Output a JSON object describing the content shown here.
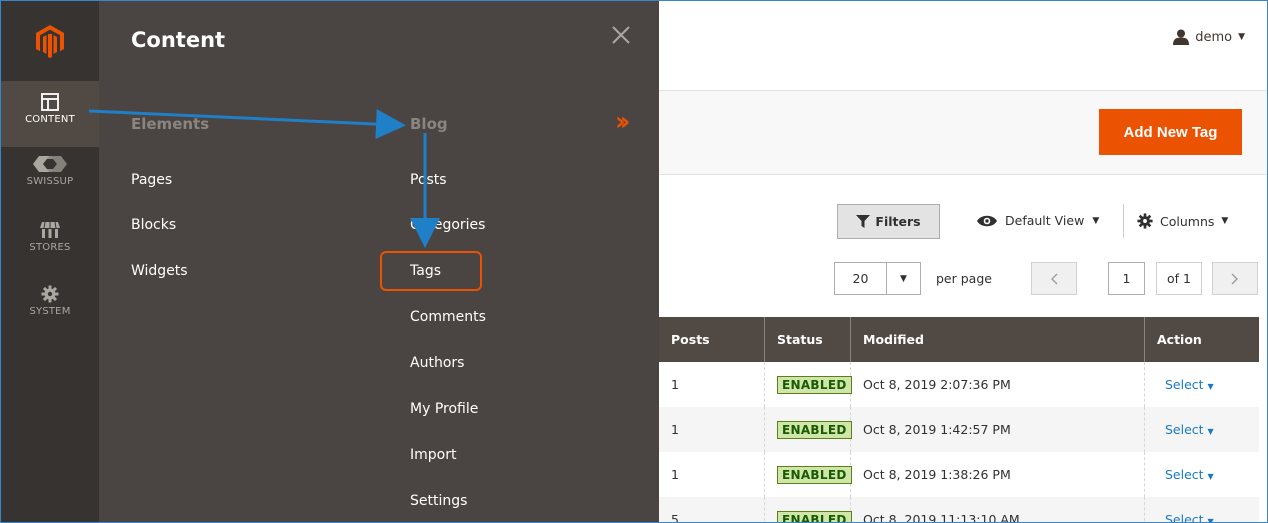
{
  "sidebar": {
    "logo": "magento-logo",
    "items": [
      {
        "label": "CONTENT",
        "icon": "layout-icon",
        "active": true
      },
      {
        "label": "SWISSUP",
        "icon": "swissup-icon",
        "active": false
      },
      {
        "label": "STORES",
        "icon": "store-icon",
        "active": false
      },
      {
        "label": "SYSTEM",
        "icon": "gear-icon",
        "active": false
      }
    ]
  },
  "menu": {
    "title": "Content",
    "elements": {
      "heading": "Elements",
      "links": [
        "Pages",
        "Blocks",
        "Widgets"
      ]
    },
    "blog": {
      "heading": "Blog",
      "links": [
        "Posts",
        "Categories",
        "Tags",
        "Comments",
        "Authors",
        "My Profile",
        "Import",
        "Settings"
      ]
    }
  },
  "header": {
    "user": "demo"
  },
  "page": {
    "add_button": "Add New Tag"
  },
  "toolbar": {
    "filters": "Filters",
    "view": "Default View",
    "columns": "Columns",
    "per_page_value": "20",
    "per_page_label": "per page",
    "page_number": "1",
    "page_of": "of 1"
  },
  "table": {
    "columns": [
      "Posts",
      "Status",
      "Modified",
      "Action"
    ],
    "rows": [
      {
        "posts": "1",
        "status": "ENABLED",
        "modified": "Oct 8, 2019 2:07:36 PM",
        "action": "Select"
      },
      {
        "posts": "1",
        "status": "ENABLED",
        "modified": "Oct 8, 2019 1:42:57 PM",
        "action": "Select"
      },
      {
        "posts": "1",
        "status": "ENABLED",
        "modified": "Oct 8, 2019 1:38:26 PM",
        "action": "Select"
      },
      {
        "posts": "5",
        "status": "ENABLED",
        "modified": "Oct 8, 2019 11:13:10 AM",
        "action": "Select"
      }
    ]
  },
  "colors": {
    "accent": "#eb5202",
    "sidebar": "#373330",
    "menu": "#4a4542",
    "annotation": "#1f7fc7"
  }
}
